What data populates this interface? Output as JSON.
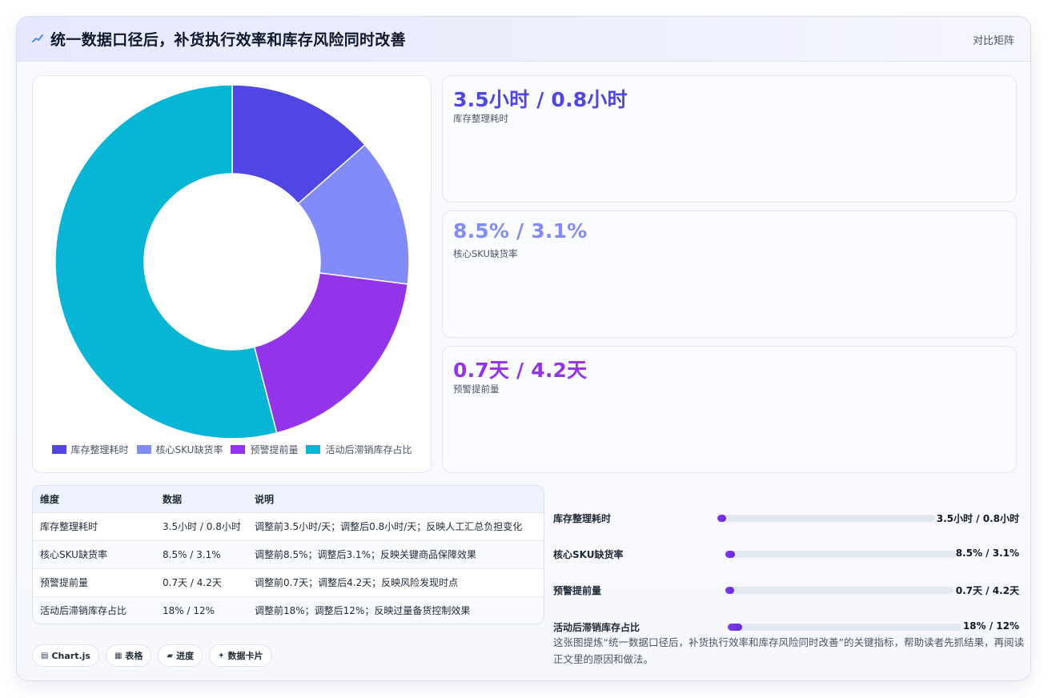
{
  "header": {
    "title": "统一数据口径后，补货执行效率和库存风险同时改善",
    "matrix_link": "对比矩阵",
    "logo_icon": "chart-line-icon"
  },
  "chart_data": {
    "type": "pie",
    "variant": "donut",
    "categories": [
      "库存整理耗时",
      "核心SKU缺货率",
      "预警提前量",
      "活动后滞销库存占比"
    ],
    "values": [
      3.5,
      3.5,
      4.9,
      14
    ],
    "colors": [
      "#4f46e5",
      "#818cf8",
      "#9333ea",
      "#06b6d4"
    ],
    "legend_position": "bottom"
  },
  "kpis": [
    {
      "value": "3.5小时 / 0.8小时",
      "label": "库存整理耗时",
      "color": "#4f46e5"
    },
    {
      "value": "8.5% / 3.1%",
      "label": "核心SKU缺货率",
      "color": "#818cf8"
    },
    {
      "value": "0.7天 / 4.2天",
      "label": "预警提前量",
      "color": "#9333ea"
    }
  ],
  "table": {
    "headers": [
      "维度",
      "数据",
      "说明"
    ],
    "rows": [
      [
        "库存整理耗时",
        "3.5小时 / 0.8小时",
        "调整前3.5小时/天；调整后0.8小时/天；反映人工汇总负担变化"
      ],
      [
        "核心SKU缺货率",
        "8.5% / 3.1%",
        "调整前8.5%；调整后3.1%；反映关键商品保障效果"
      ],
      [
        "预警提前量",
        "0.7天 / 4.2天",
        "调整前0.7天；调整后4.2天；反映风险发现时点"
      ],
      [
        "活动后滞销库存占比",
        "18% / 12%",
        "调整前18%；调整后12%；反映过量备货控制效果"
      ]
    ]
  },
  "progress": [
    {
      "label": "库存整理耗时",
      "value": "3.5小时 / 0.8小时",
      "fraction": 0.04
    },
    {
      "label": "核心SKU缺货率",
      "value": "8.5% / 3.1%",
      "fraction": 0.04
    },
    {
      "label": "预警提前量",
      "value": "0.7天 / 4.2天",
      "fraction": 0.04
    },
    {
      "label": "活动后滞销库存占比",
      "value": "18% / 12%",
      "fraction": 0.06
    }
  ],
  "note": "这张图提炼“统一数据口径后，补货执行效率和库存风险同时改善”的关键指标，帮助读者先抓结果，再阅读正文里的原因和做法。",
  "chips": [
    {
      "icon": "▤",
      "label": "Chart.js",
      "icon_name": "chart-icon"
    },
    {
      "icon": "▦",
      "label": "表格",
      "icon_name": "table-icon"
    },
    {
      "icon": "▰",
      "label": "进度",
      "icon_name": "progress-icon"
    },
    {
      "icon": "✦",
      "label": "数据卡片",
      "icon_name": "sparkle-icon"
    }
  ]
}
